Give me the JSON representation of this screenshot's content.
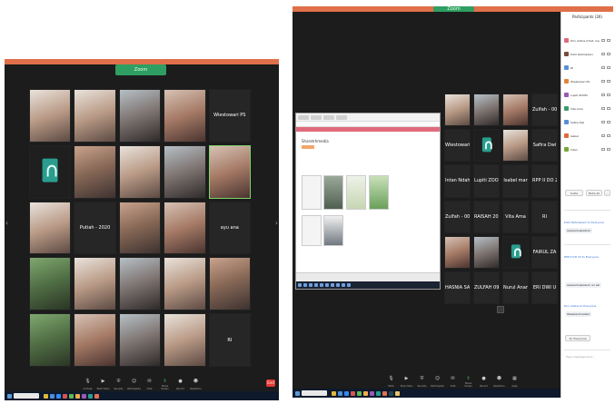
{
  "left_window": {
    "meeting_label": "Zoom",
    "tiles": [
      {
        "type": "photo",
        "style": "alt1",
        "name": "",
        "text": ""
      },
      {
        "type": "photo",
        "style": "alt1",
        "name": "",
        "text": ""
      },
      {
        "type": "photo",
        "style": "alt2",
        "name": "",
        "text": ""
      },
      {
        "type": "photo",
        "style": "alt3",
        "name": "",
        "text": ""
      },
      {
        "type": "dark",
        "style": "",
        "name": "",
        "text": "Wiestowari PS"
      },
      {
        "type": "avatar",
        "style": "",
        "name": "",
        "text": ""
      },
      {
        "type": "photo",
        "style": "",
        "name": "",
        "text": ""
      },
      {
        "type": "photo",
        "style": "alt1",
        "name": "",
        "text": ""
      },
      {
        "type": "photo",
        "style": "alt2",
        "name": "",
        "text": ""
      },
      {
        "type": "photo",
        "style": "alt3",
        "name": "",
        "text": "",
        "active": true
      },
      {
        "type": "photo",
        "style": "alt1",
        "name": "",
        "text": ""
      },
      {
        "type": "dark",
        "style": "",
        "name": "",
        "text": "Putiah - 2020"
      },
      {
        "type": "photo",
        "style": "",
        "name": "",
        "text": ""
      },
      {
        "type": "photo",
        "style": "alt3",
        "name": "",
        "text": ""
      },
      {
        "type": "dark",
        "style": "",
        "name": "",
        "text": "ayu ana"
      },
      {
        "type": "photo",
        "style": "green",
        "name": "",
        "text": ""
      },
      {
        "type": "photo",
        "style": "alt1",
        "name": "",
        "text": ""
      },
      {
        "type": "photo",
        "style": "alt2",
        "name": "",
        "text": ""
      },
      {
        "type": "photo",
        "style": "alt1",
        "name": "",
        "text": ""
      },
      {
        "type": "photo",
        "style": "",
        "name": "",
        "text": ""
      },
      {
        "type": "photo",
        "style": "green",
        "name": "",
        "text": ""
      },
      {
        "type": "photo",
        "style": "alt3",
        "name": "",
        "text": ""
      },
      {
        "type": "photo",
        "style": "alt2",
        "name": "",
        "text": ""
      },
      {
        "type": "photo",
        "style": "alt1",
        "name": "",
        "text": ""
      },
      {
        "type": "dark",
        "style": "",
        "name": "",
        "text": "RI"
      }
    ],
    "toolbar": [
      {
        "icon": "mic-icon",
        "label": "Unmute"
      },
      {
        "icon": "video-icon",
        "label": "Start Video"
      },
      {
        "icon": "security-icon",
        "label": "Security"
      },
      {
        "icon": "participants-icon",
        "label": "Participants"
      },
      {
        "icon": "chat-icon",
        "label": "Chat"
      },
      {
        "icon": "share-icon",
        "label": "Share Screen"
      },
      {
        "icon": "record-icon",
        "label": "Record"
      },
      {
        "icon": "reactions-icon",
        "label": "Reactions"
      }
    ],
    "end_label": "End"
  },
  "right_window": {
    "meeting_label": "Zoom",
    "share": {
      "title": "Sharetrhmedia",
      "thumb_captions": [
        "",
        "",
        "",
        "",
        "",
        ""
      ]
    },
    "tiles": [
      {
        "type": "photo",
        "style": "alt1",
        "text": ""
      },
      {
        "type": "photo",
        "style": "alt2",
        "text": ""
      },
      {
        "type": "photo",
        "style": "alt3",
        "text": ""
      },
      {
        "type": "dark",
        "style": "",
        "text": "Zulfah - 002"
      },
      {
        "type": "dark",
        "style": "",
        "text": "Wiestowari PS"
      },
      {
        "type": "avatar",
        "style": "",
        "text": ""
      },
      {
        "type": "photo",
        "style": "alt1",
        "text": ""
      },
      {
        "type": "dark",
        "style": "",
        "text": "Safira Dwi"
      },
      {
        "type": "dark",
        "style": "",
        "text": "Intan Ndah"
      },
      {
        "type": "dark",
        "style": "",
        "text": "Lupiti ZOOM"
      },
      {
        "type": "dark",
        "style": "",
        "text": "Isabel mar"
      },
      {
        "type": "dark",
        "style": "",
        "text": "RPP II DO 23"
      },
      {
        "type": "dark",
        "style": "",
        "text": "Zulfah - 0003"
      },
      {
        "type": "dark",
        "style": "",
        "text": "RAISAH 2020"
      },
      {
        "type": "dark",
        "style": "",
        "text": "Vita Ama"
      },
      {
        "type": "dark",
        "style": "",
        "text": "RI"
      },
      {
        "type": "photo",
        "style": "alt3",
        "text": ""
      },
      {
        "type": "photo",
        "style": "alt2",
        "text": ""
      },
      {
        "type": "avatar",
        "style": "",
        "text": ""
      },
      {
        "type": "dark",
        "style": "",
        "text": "FAIRUL ZA"
      },
      {
        "type": "dark",
        "style": "",
        "text": "HASNIA SA"
      },
      {
        "type": "dark",
        "style": "",
        "text": "ZULFAH 09"
      },
      {
        "type": "dark",
        "style": "",
        "text": "Nurul Ananda"
      },
      {
        "type": "dark",
        "style": "",
        "text": "ERI DWI U"
      }
    ],
    "toolbar": [
      {
        "icon": "mic-icon",
        "label": "Mute"
      },
      {
        "icon": "video-icon",
        "label": "Stop Video"
      },
      {
        "icon": "security-icon",
        "label": "Security"
      },
      {
        "icon": "participants-icon",
        "label": "Participants"
      },
      {
        "icon": "chat-icon",
        "label": "Chat"
      },
      {
        "icon": "share-icon",
        "label": "Share Screen"
      },
      {
        "icon": "record-icon",
        "label": "Record"
      },
      {
        "icon": "reactions-icon",
        "label": "Reactions"
      },
      {
        "icon": "apps-icon",
        "label": "Apps"
      }
    ],
    "end_label": "End"
  },
  "participants_panel": {
    "title": "Participants (26)",
    "participants": [
      {
        "name": "Dini Aldina (Host, me)",
        "color": "#e06a7c"
      },
      {
        "name": "Putri Rahmadani",
        "color": "#7a4a3a"
      },
      {
        "name": "RI",
        "color": "#5b8fd6"
      },
      {
        "name": "Wiestowari PS",
        "color": "#e0853a"
      },
      {
        "name": "Lupiti ZOOM",
        "color": "#9b59b6"
      },
      {
        "name": "Vita Ama",
        "color": "#3a9a6a"
      },
      {
        "name": "Safira Dwi",
        "color": "#5b8fd6"
      },
      {
        "name": "Isabel",
        "color": "#e06a3a"
      },
      {
        "name": "Intan",
        "color": "#7aa83a"
      }
    ],
    "invite_label": "Invite",
    "mute_all_label": "Mute All",
    "more_label": "...",
    "chat_link_1": "Putri Rahmadani to Everyone",
    "chat_msg_1": "Assalamualaikum",
    "chat_link_2": "RPP II DO 23 to Everyone",
    "chat_msg_2": "Assalamualaikum wr wb",
    "chat_link_3": "Dini Aldina to Everyone",
    "chat_msg_3": "Waalaikumsalam",
    "to_label": "To: Everyone",
    "input_placeholder": "Type message here..."
  }
}
